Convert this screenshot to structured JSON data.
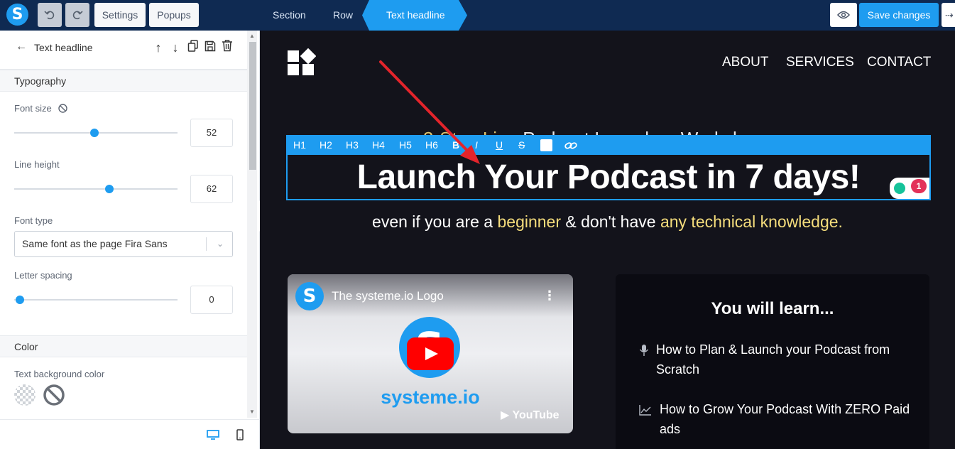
{
  "topbar": {
    "logo_letter": "S",
    "undo_icon": "undo-icon",
    "redo_icon": "redo-icon",
    "settings_label": "Settings",
    "popups_label": "Popups",
    "breadcrumbs": [
      "Section",
      "Row",
      "Text headline"
    ],
    "preview_icon": "eye-icon",
    "save_label": "Save changes",
    "exit_icon": "exit-icon"
  },
  "panel": {
    "title": "Text headline",
    "typography_label": "Typography",
    "font_size_label": "Font size",
    "font_size_value": "52",
    "font_size_fraction": 0.48,
    "line_height_label": "Line height",
    "line_height_value": "62",
    "line_height_fraction": 0.58,
    "font_type_label": "Font type",
    "font_type_value": "Same font as the page Fira Sans",
    "letter_spacing_label": "Letter spacing",
    "letter_spacing_value": "0",
    "letter_spacing_fraction": 0.0,
    "color_label": "Color",
    "text_bg_label": "Text background color"
  },
  "canvas": {
    "nav": [
      "ABOUT",
      "SERVICES",
      "CONTACT"
    ],
    "ghost_text_pre": "3-Ste   Lin   ",
    "ghost_text_post": "Podcast Launch     Workshop",
    "format_bar": [
      "H1",
      "H2",
      "H3",
      "H4",
      "H5",
      "H6",
      "B",
      "I",
      "U",
      "S"
    ],
    "headline": "Launch Your Podcast in 7 days!",
    "grammar_count": "1",
    "sub_1": "even if you are a ",
    "sub_2": "beginner",
    "sub_3": " & don't have ",
    "sub_4": "any technical knowledge.",
    "video": {
      "avatar_letter": "S",
      "title": "The systeme.io Logo",
      "menu": "⋮",
      "circle_letter": "S",
      "brand": "systeme.io",
      "youtube": "▶ YouTube"
    },
    "learn_title": "You will learn...",
    "learn_items": [
      "How to Plan & Launch your Podcast from Scratch",
      "How to Grow Your Podcast With ZERO Paid ads"
    ]
  },
  "colors": {
    "accent": "#1e9cf0",
    "topbar": "#0f2a52",
    "canvas_bg": "#13131b",
    "highlight": "#f5dd7c",
    "arrow": "#e3242b"
  }
}
